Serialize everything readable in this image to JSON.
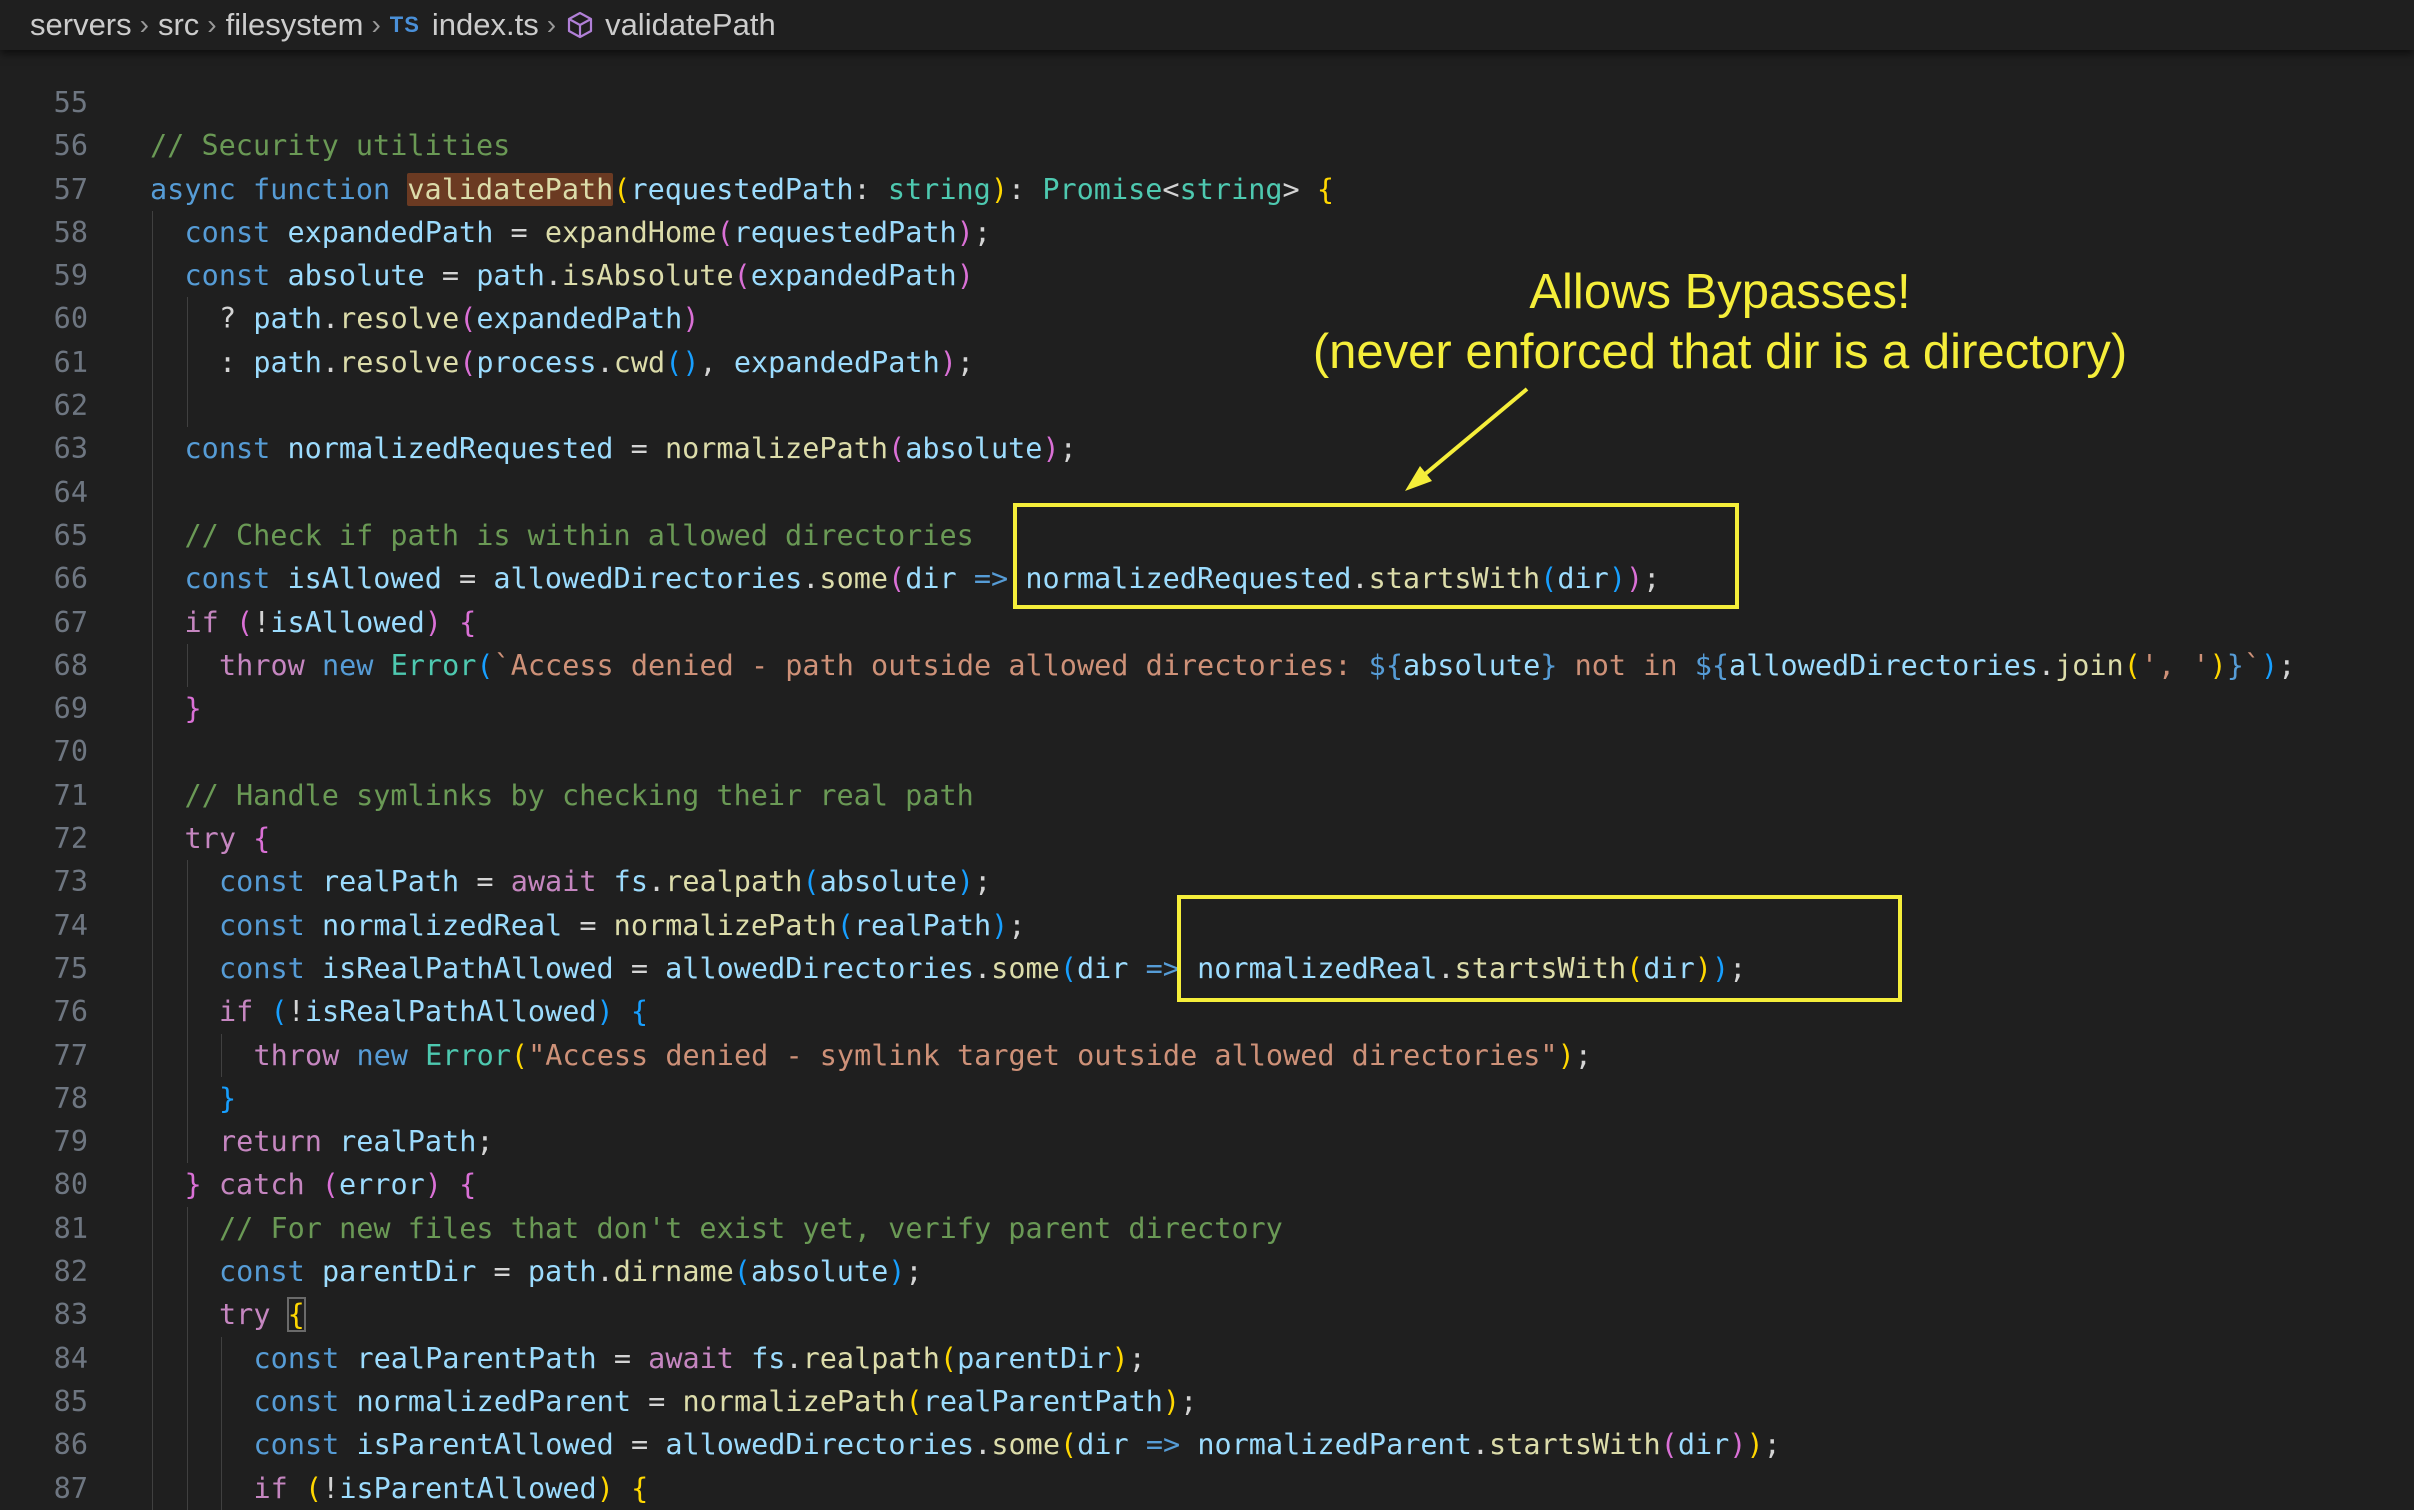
{
  "breadcrumb": {
    "items": [
      "servers",
      "src",
      "filesystem",
      "index.ts",
      "validatePath"
    ],
    "ts_badge": "TS",
    "separator": "›"
  },
  "editor": {
    "lines": [
      {
        "n": "55",
        "indent": 0,
        "tokens": []
      },
      {
        "n": "56",
        "indent": 0,
        "tokens": [
          [
            "// Security utilities",
            "cmt"
          ]
        ]
      },
      {
        "n": "57",
        "indent": 0,
        "tokens": [
          [
            "async ",
            "kw"
          ],
          [
            "function ",
            "kw"
          ],
          [
            "validatePath",
            "hl"
          ],
          [
            "(",
            "b1"
          ],
          [
            "requestedPath",
            "var"
          ],
          [
            ": ",
            "plain"
          ],
          [
            "string",
            "type"
          ],
          [
            "",
            "plain"
          ],
          [
            ")",
            "b1"
          ],
          [
            ": ",
            "plain"
          ],
          [
            "Promise",
            "type"
          ],
          [
            "<",
            "plain"
          ],
          [
            "string",
            "type"
          ],
          [
            ">",
            "plain"
          ],
          [
            " ",
            "plain"
          ],
          [
            "{",
            "b1"
          ]
        ]
      },
      {
        "n": "58",
        "indent": 1,
        "tokens": [
          [
            "const ",
            "kw"
          ],
          [
            "expandedPath",
            "var"
          ],
          [
            " = ",
            "plain"
          ],
          [
            "expandHome",
            "fn"
          ],
          [
            "(",
            "b2"
          ],
          [
            "requestedPath",
            "var"
          ],
          [
            ")",
            "b2"
          ],
          [
            ";",
            "plain"
          ]
        ]
      },
      {
        "n": "59",
        "indent": 1,
        "tokens": [
          [
            "const ",
            "kw"
          ],
          [
            "absolute",
            "var"
          ],
          [
            " = ",
            "plain"
          ],
          [
            "path",
            "var"
          ],
          [
            ".",
            "plain"
          ],
          [
            "isAbsolute",
            "fn"
          ],
          [
            "(",
            "b2"
          ],
          [
            "expandedPath",
            "var"
          ],
          [
            ")",
            "b2"
          ]
        ]
      },
      {
        "n": "60",
        "indent": 2,
        "tokens": [
          [
            "? ",
            "plain"
          ],
          [
            "path",
            "var"
          ],
          [
            ".",
            "plain"
          ],
          [
            "resolve",
            "fn"
          ],
          [
            "(",
            "b2"
          ],
          [
            "expandedPath",
            "var"
          ],
          [
            ")",
            "b2"
          ]
        ]
      },
      {
        "n": "61",
        "indent": 2,
        "tokens": [
          [
            ": ",
            "plain"
          ],
          [
            "path",
            "var"
          ],
          [
            ".",
            "plain"
          ],
          [
            "resolve",
            "fn"
          ],
          [
            "(",
            "b2"
          ],
          [
            "process",
            "var"
          ],
          [
            ".",
            "plain"
          ],
          [
            "cwd",
            "fn"
          ],
          [
            "()",
            "b3"
          ],
          [
            ", ",
            "plain"
          ],
          [
            "expandedPath",
            "var"
          ],
          [
            ")",
            "b2"
          ],
          [
            ";",
            "plain"
          ]
        ]
      },
      {
        "n": "62",
        "indent": 2,
        "tokens": []
      },
      {
        "n": "63",
        "indent": 1,
        "tokens": [
          [
            "const ",
            "kw"
          ],
          [
            "normalizedRequested",
            "var"
          ],
          [
            " = ",
            "plain"
          ],
          [
            "normalizePath",
            "fn"
          ],
          [
            "(",
            "b2"
          ],
          [
            "absolute",
            "var"
          ],
          [
            ")",
            "b2"
          ],
          [
            ";",
            "plain"
          ]
        ]
      },
      {
        "n": "64",
        "indent": 1,
        "tokens": []
      },
      {
        "n": "65",
        "indent": 1,
        "tokens": [
          [
            "// Check if path is within allowed directories",
            "cmt"
          ]
        ]
      },
      {
        "n": "66",
        "indent": 1,
        "tokens": [
          [
            "const ",
            "kw"
          ],
          [
            "isAllowed",
            "var"
          ],
          [
            " = ",
            "plain"
          ],
          [
            "allowedDirectories",
            "var"
          ],
          [
            ".",
            "plain"
          ],
          [
            "some",
            "fn"
          ],
          [
            "(",
            "b2"
          ],
          [
            "dir",
            "var"
          ],
          [
            " ",
            "plain"
          ],
          [
            "=>",
            "kw"
          ],
          [
            " ",
            "plain"
          ],
          [
            "normalizedRequested",
            "var"
          ],
          [
            ".",
            "plain"
          ],
          [
            "startsWith",
            "fn"
          ],
          [
            "(",
            "b3"
          ],
          [
            "dir",
            "var"
          ],
          [
            ")",
            "b3"
          ],
          [
            ")",
            "b2"
          ],
          [
            ";",
            "plain"
          ]
        ]
      },
      {
        "n": "67",
        "indent": 1,
        "tokens": [
          [
            "if ",
            "ctl"
          ],
          [
            "(",
            "b2"
          ],
          [
            "!",
            "plain"
          ],
          [
            "isAllowed",
            "var"
          ],
          [
            ")",
            "b2"
          ],
          [
            " ",
            "plain"
          ],
          [
            "{",
            "b2"
          ]
        ]
      },
      {
        "n": "68",
        "indent": 2,
        "tokens": [
          [
            "throw ",
            "ctl"
          ],
          [
            "new ",
            "kw"
          ],
          [
            "Error",
            "type"
          ],
          [
            "(",
            "b3"
          ],
          [
            "`Access denied - path outside allowed directories: ",
            "str"
          ],
          [
            "${",
            "kw"
          ],
          [
            "absolute",
            "var"
          ],
          [
            "}",
            "kw"
          ],
          [
            " not in ",
            "str"
          ],
          [
            "${",
            "kw"
          ],
          [
            "allowedDirectories",
            "var"
          ],
          [
            ".",
            "plain"
          ],
          [
            "join",
            "fn"
          ],
          [
            "(",
            "b1"
          ],
          [
            "', '",
            "str"
          ],
          [
            ")",
            "b1"
          ],
          [
            "}",
            "kw"
          ],
          [
            "`",
            "str"
          ],
          [
            ")",
            "b3"
          ],
          [
            ";",
            "plain"
          ]
        ]
      },
      {
        "n": "69",
        "indent": 1,
        "tokens": [
          [
            "}",
            "b2"
          ]
        ]
      },
      {
        "n": "70",
        "indent": 1,
        "tokens": []
      },
      {
        "n": "71",
        "indent": 1,
        "tokens": [
          [
            "// Handle symlinks by checking their real path",
            "cmt"
          ]
        ]
      },
      {
        "n": "72",
        "indent": 1,
        "tokens": [
          [
            "try ",
            "ctl"
          ],
          [
            "{",
            "b2"
          ]
        ]
      },
      {
        "n": "73",
        "indent": 2,
        "tokens": [
          [
            "const ",
            "kw"
          ],
          [
            "realPath",
            "var"
          ],
          [
            " = ",
            "plain"
          ],
          [
            "await ",
            "ctl"
          ],
          [
            "fs",
            "var"
          ],
          [
            ".",
            "plain"
          ],
          [
            "realpath",
            "fn"
          ],
          [
            "(",
            "b3"
          ],
          [
            "absolute",
            "var"
          ],
          [
            ")",
            "b3"
          ],
          [
            ";",
            "plain"
          ]
        ]
      },
      {
        "n": "74",
        "indent": 2,
        "tokens": [
          [
            "const ",
            "kw"
          ],
          [
            "normalizedReal",
            "var"
          ],
          [
            " = ",
            "plain"
          ],
          [
            "normalizePath",
            "fn"
          ],
          [
            "(",
            "b3"
          ],
          [
            "realPath",
            "var"
          ],
          [
            ")",
            "b3"
          ],
          [
            ";",
            "plain"
          ]
        ]
      },
      {
        "n": "75",
        "indent": 2,
        "tokens": [
          [
            "const ",
            "kw"
          ],
          [
            "isRealPathAllowed",
            "var"
          ],
          [
            " = ",
            "plain"
          ],
          [
            "allowedDirectories",
            "var"
          ],
          [
            ".",
            "plain"
          ],
          [
            "some",
            "fn"
          ],
          [
            "(",
            "b3"
          ],
          [
            "dir",
            "var"
          ],
          [
            " ",
            "plain"
          ],
          [
            "=>",
            "kw"
          ],
          [
            " ",
            "plain"
          ],
          [
            "normalizedReal",
            "var"
          ],
          [
            ".",
            "plain"
          ],
          [
            "startsWith",
            "fn"
          ],
          [
            "(",
            "b1"
          ],
          [
            "dir",
            "var"
          ],
          [
            ")",
            "b1"
          ],
          [
            ")",
            "b3"
          ],
          [
            ";",
            "plain"
          ]
        ]
      },
      {
        "n": "76",
        "indent": 2,
        "tokens": [
          [
            "if ",
            "ctl"
          ],
          [
            "(",
            "b3"
          ],
          [
            "!",
            "plain"
          ],
          [
            "isRealPathAllowed",
            "var"
          ],
          [
            ")",
            "b3"
          ],
          [
            " ",
            "plain"
          ],
          [
            "{",
            "b3"
          ]
        ]
      },
      {
        "n": "77",
        "indent": 3,
        "tokens": [
          [
            "throw ",
            "ctl"
          ],
          [
            "new ",
            "kw"
          ],
          [
            "Error",
            "type"
          ],
          [
            "(",
            "b1"
          ],
          [
            "\"Access denied - symlink target outside allowed directories\"",
            "str"
          ],
          [
            ")",
            "b1"
          ],
          [
            ";",
            "plain"
          ]
        ]
      },
      {
        "n": "78",
        "indent": 2,
        "tokens": [
          [
            "}",
            "b3"
          ]
        ]
      },
      {
        "n": "79",
        "indent": 2,
        "tokens": [
          [
            "return ",
            "ctl"
          ],
          [
            "realPath",
            "var"
          ],
          [
            ";",
            "plain"
          ]
        ]
      },
      {
        "n": "80",
        "indent": 1,
        "tokens": [
          [
            "}",
            "b2"
          ],
          [
            " ",
            "plain"
          ],
          [
            "catch ",
            "ctl"
          ],
          [
            "(",
            "b2"
          ],
          [
            "error",
            "var"
          ],
          [
            ")",
            "b2"
          ],
          [
            " ",
            "plain"
          ],
          [
            "{",
            "b2"
          ]
        ]
      },
      {
        "n": "81",
        "indent": 2,
        "tokens": [
          [
            "// For new files that don't exist yet, verify parent directory",
            "cmt"
          ]
        ]
      },
      {
        "n": "82",
        "indent": 2,
        "tokens": [
          [
            "const ",
            "kw"
          ],
          [
            "parentDir",
            "var"
          ],
          [
            " = ",
            "plain"
          ],
          [
            "path",
            "var"
          ],
          [
            ".",
            "plain"
          ],
          [
            "dirname",
            "fn"
          ],
          [
            "(",
            "b3"
          ],
          [
            "absolute",
            "var"
          ],
          [
            ")",
            "b3"
          ],
          [
            ";",
            "plain"
          ]
        ]
      },
      {
        "n": "83",
        "indent": 2,
        "tokens": [
          [
            "try ",
            "ctl"
          ],
          [
            "{",
            "cursor"
          ]
        ]
      },
      {
        "n": "84",
        "indent": 3,
        "tokens": [
          [
            "const ",
            "kw"
          ],
          [
            "realParentPath",
            "var"
          ],
          [
            " = ",
            "plain"
          ],
          [
            "await ",
            "ctl"
          ],
          [
            "fs",
            "var"
          ],
          [
            ".",
            "plain"
          ],
          [
            "realpath",
            "fn"
          ],
          [
            "(",
            "b1"
          ],
          [
            "parentDir",
            "var"
          ],
          [
            ")",
            "b1"
          ],
          [
            ";",
            "plain"
          ]
        ]
      },
      {
        "n": "85",
        "indent": 3,
        "tokens": [
          [
            "const ",
            "kw"
          ],
          [
            "normalizedParent",
            "var"
          ],
          [
            " = ",
            "plain"
          ],
          [
            "normalizePath",
            "fn"
          ],
          [
            "(",
            "b1"
          ],
          [
            "realParentPath",
            "var"
          ],
          [
            ")",
            "b1"
          ],
          [
            ";",
            "plain"
          ]
        ]
      },
      {
        "n": "86",
        "indent": 3,
        "tokens": [
          [
            "const ",
            "kw"
          ],
          [
            "isParentAllowed",
            "var"
          ],
          [
            " = ",
            "plain"
          ],
          [
            "allowedDirectories",
            "var"
          ],
          [
            ".",
            "plain"
          ],
          [
            "some",
            "fn"
          ],
          [
            "(",
            "b1"
          ],
          [
            "dir",
            "var"
          ],
          [
            " ",
            "plain"
          ],
          [
            "=>",
            "kw"
          ],
          [
            " ",
            "plain"
          ],
          [
            "normalizedParent",
            "var"
          ],
          [
            ".",
            "plain"
          ],
          [
            "startsWith",
            "fn"
          ],
          [
            "(",
            "b2"
          ],
          [
            "dir",
            "var"
          ],
          [
            ")",
            "b2"
          ],
          [
            ")",
            "b1"
          ],
          [
            ";",
            "plain"
          ]
        ]
      },
      {
        "n": "87",
        "indent": 3,
        "tokens": [
          [
            "if ",
            "ctl"
          ],
          [
            "(",
            "b1"
          ],
          [
            "!",
            "plain"
          ],
          [
            "isParentAllowed",
            "var"
          ],
          [
            ")",
            "b1"
          ],
          [
            " ",
            "plain"
          ],
          [
            "{",
            "b1"
          ]
        ]
      }
    ]
  },
  "annotation": {
    "line1": "Allows Bypasses!",
    "line2": "(never enforced that dir is a directory)",
    "color": "#f5ee3a"
  },
  "colors": {
    "background": "#1f1f1f",
    "line_number": "#6e7681",
    "highlight": "#6b3a22"
  }
}
